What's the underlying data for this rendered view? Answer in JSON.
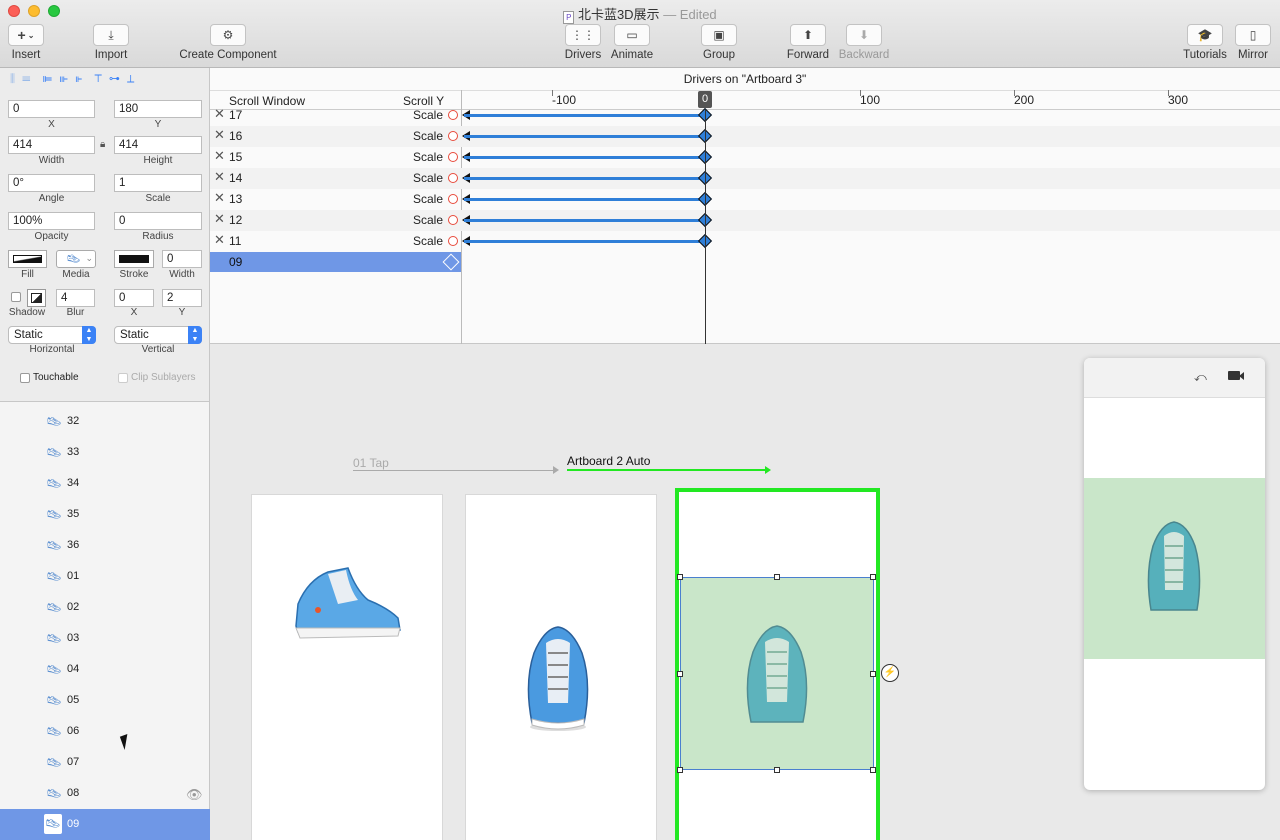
{
  "window": {
    "title": "北卡蓝3D展示",
    "status": "— Edited",
    "doc_badge": "P"
  },
  "toolbar": {
    "insert": "Insert",
    "import": "Import",
    "create_component": "Create Component",
    "drivers": "Drivers",
    "animate": "Animate",
    "group": "Group",
    "forward": "Forward",
    "backward": "Backward",
    "tutorials": "Tutorials",
    "mirror": "Mirror"
  },
  "inspector": {
    "x": "0",
    "y": "180",
    "width": "414",
    "height": "414",
    "angle": "0°",
    "scale": "1",
    "opacity": "100%",
    "radius": "0",
    "stroke_width": "0",
    "shadow_blur": "4",
    "shadow_x": "0",
    "shadow_y": "2",
    "horizontal": "Static",
    "vertical": "Static",
    "labels": {
      "x": "X",
      "y": "Y",
      "width": "Width",
      "height": "Height",
      "angle": "Angle",
      "scale": "Scale",
      "opacity": "Opacity",
      "radius": "Radius",
      "fill": "Fill",
      "media": "Media",
      "stroke": "Stroke",
      "stroke_width": "Width",
      "shadow": "Shadow",
      "blur": "Blur",
      "sx": "X",
      "sy": "Y",
      "horizontal": "Horizontal",
      "vertical": "Vertical",
      "touchable": "Touchable",
      "clip": "Clip Sublayers"
    }
  },
  "layers": [
    "32",
    "33",
    "34",
    "35",
    "36",
    "01",
    "02",
    "03",
    "04",
    "05",
    "06",
    "07",
    "08",
    "09"
  ],
  "drivers_panel": {
    "title": "Drivers on \"Artboard 3\"",
    "col_source": "Scroll Window",
    "col_prop": "Scroll Y",
    "ruler": [
      "-100",
      "0",
      "100",
      "200",
      "300"
    ],
    "rows": [
      {
        "name": "17",
        "prop": "Scale"
      },
      {
        "name": "16",
        "prop": "Scale"
      },
      {
        "name": "15",
        "prop": "Scale"
      },
      {
        "name": "14",
        "prop": "Scale"
      },
      {
        "name": "13",
        "prop": "Scale"
      },
      {
        "name": "12",
        "prop": "Scale"
      },
      {
        "name": "11",
        "prop": "Scale"
      }
    ],
    "selected_row": "09"
  },
  "canvas": {
    "link1": "01 Tap",
    "link2": "Artboard 2 Auto",
    "tap_glyph": "⚡"
  },
  "colors": {
    "accent": "#6f97e6",
    "link_green": "#22e822",
    "selection_fill": "#c9e6c9",
    "driver_line": "#2f7fd8"
  }
}
